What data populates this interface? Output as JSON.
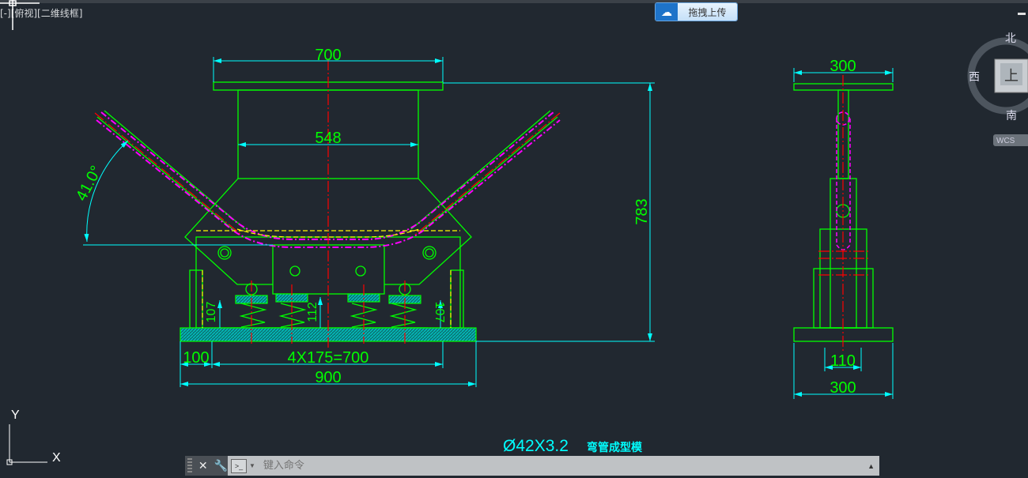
{
  "viewport": {
    "label": "[-][俯视][二维线框]"
  },
  "upload_button": {
    "label": "拖拽上传",
    "icon": "cloud-upload-icon"
  },
  "viewcube": {
    "north": "北",
    "south": "南",
    "west": "西",
    "face": "上",
    "wcs": "WCS"
  },
  "drawing": {
    "front": {
      "dim_top": "700",
      "dim_column": "548",
      "dim_height": "783",
      "angle": "41.0°",
      "dim_left": "100",
      "dim_pitch": "4X175=700",
      "dim_total": "900",
      "dim_h1": "107",
      "dim_h2": "112",
      "dim_h3": "107"
    },
    "side": {
      "dim_top": "300",
      "dim_mid": "110",
      "dim_bottom": "300"
    },
    "title_size": "Ø42X3.2",
    "title_name": "弯管成型模"
  },
  "ucs": {
    "x": "X",
    "y": "Y"
  },
  "command": {
    "placeholder": "键入命令"
  },
  "colors": {
    "background": "#212830",
    "green": "#00ff00",
    "cyan": "#00ffff",
    "red": "#ff0000",
    "yellow": "#ffff00",
    "magenta": "#ff00ff"
  }
}
